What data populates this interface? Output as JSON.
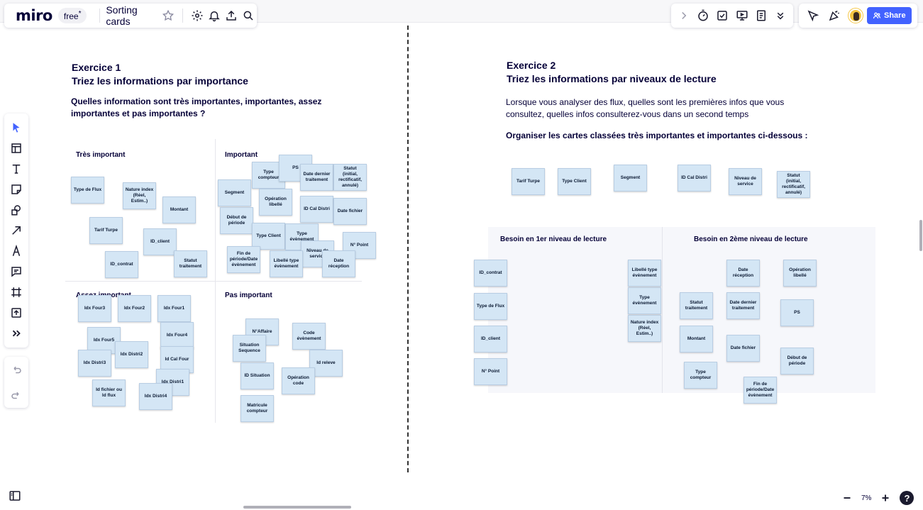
{
  "topbar": {
    "logo": "miro",
    "plan": "free",
    "plan_star": "*",
    "board_title": "Sorting cards",
    "share_label": "Share"
  },
  "zoom": {
    "level": "7%"
  },
  "exercise1": {
    "title_line1": "Exercice 1",
    "title_line2": "Triez les informations par importance",
    "question": "Quelles information sont très importantes, importantes, assez importantes et pas importantes ?",
    "quadrants": {
      "tres_important": "Très important",
      "important": "Important",
      "assez_important": "Assez important",
      "pas_important": "Pas important"
    }
  },
  "exercise2": {
    "title_line1": "Exercice 2",
    "title_line2": "Triez les informations par niveaux de lecture",
    "paragraph": "Lorsque vous analyser des flux, quelles sont les premières infos que vous consultez, quelles infos consulterez-vous dans un second temps",
    "instruction": "Organiser les cartes classées très importantes et importantes ci-dessous :",
    "zone1_title": "Besoin en 1er niveau de lecture",
    "zone2_title": "Besoin en 2ème niveau de lecture"
  },
  "cards": [
    "Type de   Flux",
    "Nature index (Réel, Estim..)",
    "Montant",
    "Tarif Turpe",
    "ID_client",
    "ID_contrat",
    "Statut traitement",
    "Type compteur",
    "PS",
    "Date dernier traitement",
    "Statut (initial, rectificatif, annulé)",
    "Segment",
    "Opération libellé",
    "ID Cal Distri",
    "Date fichier",
    "Début de période",
    "Type Client",
    "Type évènement",
    "N° Point",
    "Niveau de service",
    "Fin de période/Date évènement",
    "Libellé type évènement",
    "Date réception",
    "Idx Four3",
    "Idx Four2",
    "Idx Four1",
    "Idx Four4",
    "Idx Four5",
    "Idx Distri2",
    "Id Cal Four",
    "Idx Distri3",
    "Idx Distri1",
    "Id fichier ou Id flux",
    "Idx Distri4",
    "N°Affaire",
    "Code évènement",
    "Situation Sequence",
    "Id releve",
    "ID Situation",
    "Opération code",
    "Matricule compteur",
    "Tarif Turpe",
    "Type Client",
    "Segment",
    "ID Cal Distri",
    "Niveau de service",
    "Statut (initial, rectificatif, annulé)",
    "ID_contrat",
    "Type de   Flux",
    "ID_client",
    "N° Point",
    "Libellé type évènement",
    "Type évènement",
    "Nature index (Réel, Estim..)",
    "Date réception",
    "Opération libellé",
    "Statut traitement",
    "Date dernier traitement",
    "PS",
    "Montant",
    "Date fichier",
    "Début de période",
    "Type compteur",
    "Fin de période/Date évènement"
  ]
}
